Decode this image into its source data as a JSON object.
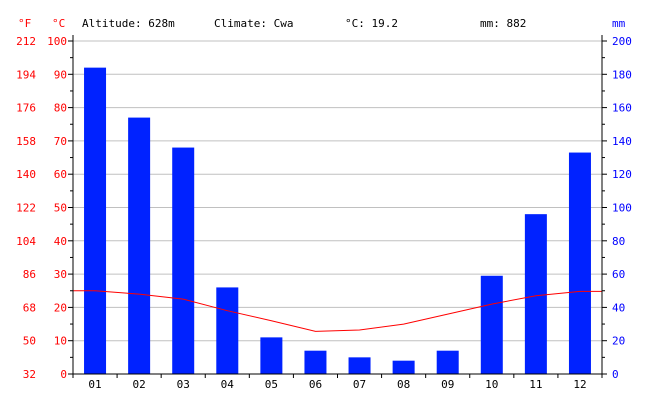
{
  "header": {
    "f_unit": "°F",
    "c_unit": "°C",
    "altitude": "Altitude: 628m",
    "climate": "Climate: Cwa",
    "temp_mean": "°C: 19.2",
    "precip_total": "mm: 882",
    "mm_unit": "mm"
  },
  "colors": {
    "precip_bar": "#0022ff",
    "temp_line": "#ff0000",
    "temp_axis": "#ff0000",
    "precip_axis": "#0000ff",
    "grid": "#c0c0c0"
  },
  "chart_data": {
    "type": "bar",
    "categories": [
      "01",
      "02",
      "03",
      "04",
      "05",
      "06",
      "07",
      "08",
      "09",
      "10",
      "11",
      "12"
    ],
    "series": [
      {
        "values": [
          184,
          154,
          136,
          52,
          22,
          14,
          10,
          8,
          14,
          59,
          96,
          133
        ]
      },
      {
        "values": [
          25.0,
          24.0,
          22.5,
          19.0,
          16.0,
          12.8,
          13.2,
          15.0,
          18.0,
          21.0,
          23.5,
          24.8
        ]
      }
    ],
    "y_left_ticks": [
      0,
      10,
      20,
      30,
      40,
      50,
      60,
      70,
      80,
      90,
      100
    ],
    "y_left_far_ticks": [
      32,
      50,
      68,
      86,
      104,
      122,
      140,
      158,
      176,
      194,
      212
    ],
    "y_right_ticks": [
      0,
      20,
      40,
      60,
      80,
      100,
      120,
      140,
      160,
      180,
      200
    ],
    "ylim_left": [
      0,
      100
    ],
    "ylim_right": [
      0,
      200
    ],
    "grid": true
  }
}
